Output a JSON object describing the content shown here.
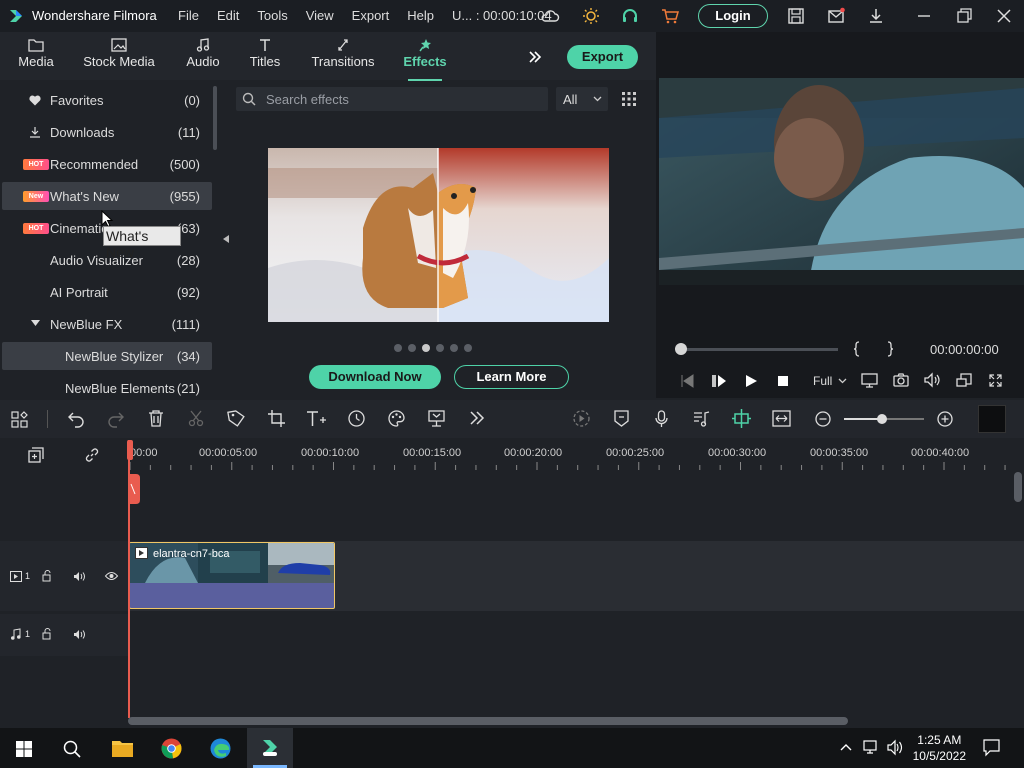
{
  "app": {
    "title": "Wondershare Filmora",
    "project": "U... : 00:00:10:04",
    "menus": [
      "File",
      "Edit",
      "Tools",
      "View",
      "Export",
      "Help"
    ],
    "login_label": "Login"
  },
  "tabs": [
    {
      "label": "Media",
      "icon": "folder-icon"
    },
    {
      "label": "Stock Media",
      "icon": "image-icon"
    },
    {
      "label": "Audio",
      "icon": "music-note-icon"
    },
    {
      "label": "Titles",
      "icon": "text-icon"
    },
    {
      "label": "Transitions",
      "icon": "transition-icon"
    },
    {
      "label": "Effects",
      "icon": "effects-star-icon",
      "active": true
    }
  ],
  "export_label": "Export",
  "sidebar": {
    "items": [
      {
        "label": "Favorites",
        "count": "(0)",
        "icon": "heart-icon"
      },
      {
        "label": "Downloads",
        "count": "(11)",
        "icon": "download-icon"
      },
      {
        "label": "Recommended",
        "count": "(500)",
        "badge": "HOT"
      },
      {
        "label": "What's New",
        "count": "(955)",
        "badge": "New",
        "selected": true
      },
      {
        "label": "Cinematic",
        "count": "(63)",
        "badge": "HOT"
      },
      {
        "label": "Audio Visualizer",
        "count": "(28)"
      },
      {
        "label": "AI Portrait",
        "count": "(92)"
      },
      {
        "label": "NewBlue FX",
        "count": "(111)",
        "expanded": true
      },
      {
        "label": "NewBlue Stylizer",
        "count": "(34)",
        "selected": true,
        "sub": true
      },
      {
        "label": "NewBlue Elements",
        "count": "(21)",
        "sub": true
      }
    ],
    "tooltip": "What's New"
  },
  "search": {
    "placeholder": "Search effects",
    "filter_value": "All"
  },
  "carousel": {
    "active_index": 2,
    "count": 6
  },
  "buttons": {
    "download_now": "Download Now",
    "learn_more": "Learn More"
  },
  "player": {
    "timecode": "00:00:00:00",
    "quality": "Full",
    "progress": 0
  },
  "timeline": {
    "ruler_labels": [
      "00:00",
      "00:00:05:00",
      "00:00:10:00",
      "00:00:15:00",
      "00:00:20:00",
      "00:00:25:00",
      "00:00:30:00",
      "00:00:35:00",
      "00:00:40:00"
    ],
    "video_track_label": "1",
    "audio_track_label": "1",
    "clip_name": "elantra-cn7-bca"
  },
  "taskbar": {
    "time": "1:25 AM",
    "date": "10/5/2022"
  },
  "colors": {
    "accent": "#4ed3a8",
    "playhead": "#e95c4f",
    "clip_border": "#f0c766",
    "clip_body": "#5a5f9e"
  }
}
